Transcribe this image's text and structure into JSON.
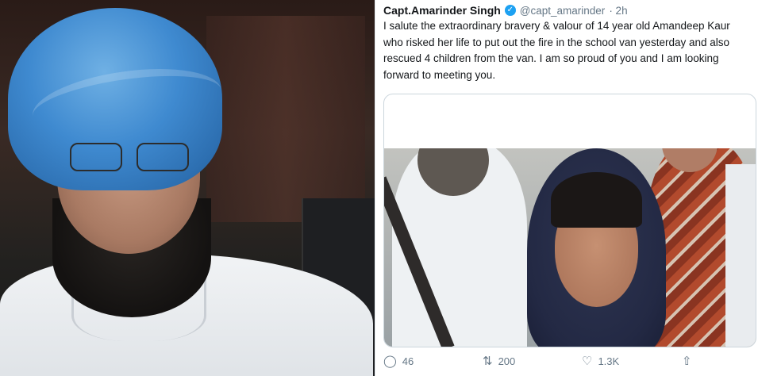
{
  "tweet": {
    "author_name": "Capt.Amarinder Singh",
    "handle": "@capt_amarinder",
    "time": "· 2h",
    "text": "I salute the extraordinary bravery & valour of 14 year old Amandeep Kaur who risked her life to put out the fire in the school van yesterday and also rescued 4 children from the van. I am so proud of you and I am looking forward to meeting you.",
    "actions": {
      "reply_count": "46",
      "retweet_count": "200",
      "like_count": "1.3K"
    }
  },
  "icons": {
    "verified": "verified-badge-icon",
    "reply": "reply-icon",
    "retweet": "retweet-icon",
    "like": "heart-icon",
    "share": "share-icon"
  },
  "colors": {
    "verified_blue": "#1da1f2",
    "text_primary": "#14171a",
    "text_secondary": "#657786"
  }
}
